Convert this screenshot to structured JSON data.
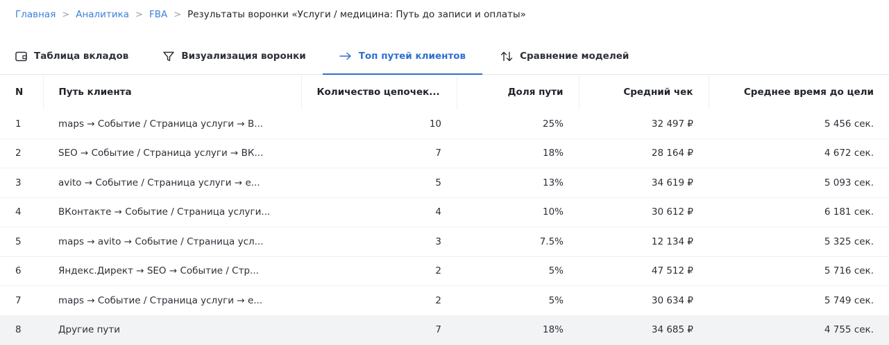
{
  "breadcrumb": {
    "items": [
      "Главная",
      "Аналитика",
      "FBA"
    ],
    "current": "Результаты воронки «Услуги / медицина: Путь до записи и оплаты»"
  },
  "tabs": [
    {
      "label": "Таблица вкладов",
      "icon": "wallet-icon",
      "active": false
    },
    {
      "label": "Визуализация воронки",
      "icon": "funnel-icon",
      "active": false
    },
    {
      "label": "Топ путей клиентов",
      "icon": "arrow-right-icon",
      "active": true
    },
    {
      "label": "Сравнение моделей",
      "icon": "sort-arrows-icon",
      "active": false
    }
  ],
  "colors": {
    "accent": "#2f6fd0",
    "link": "#3d7fd8",
    "highlight_row": "#f2f3f5"
  },
  "table": {
    "columns": [
      "N",
      "Путь клиента",
      "Количество цепочек...",
      "Доля пути",
      "Средний чек",
      "Среднее время до цели"
    ],
    "rows": [
      [
        "1",
        "maps → Событие / Страница услуги → В...",
        "10",
        "25%",
        "32 497 ₽",
        "5 456 сек."
      ],
      [
        "2",
        "SEO → Событие / Страница услуги → ВК...",
        "7",
        "18%",
        "28 164 ₽",
        "4 672 сек."
      ],
      [
        "3",
        "avito → Событие / Страница услуги → е...",
        "5",
        "13%",
        "34 619 ₽",
        "5 093 сек."
      ],
      [
        "4",
        "ВКонтакте → Событие / Страница услуги...",
        "4",
        "10%",
        "30 612 ₽",
        "6 181 сек."
      ],
      [
        "5",
        "maps → avito → Событие / Страница усл...",
        "3",
        "7.5%",
        "12 134 ₽",
        "5 325 сек."
      ],
      [
        "6",
        "Яндекс.Директ → SEO → Событие / Стр...",
        "2",
        "5%",
        "47 512 ₽",
        "5 716 сек."
      ],
      [
        "7",
        "maps → Событие / Страница услуги → е...",
        "2",
        "5%",
        "30 634 ₽",
        "5 749 сек."
      ],
      [
        "8",
        "Другие пути",
        "7",
        "18%",
        "34 685 ₽",
        "4 755 сек."
      ]
    ]
  }
}
